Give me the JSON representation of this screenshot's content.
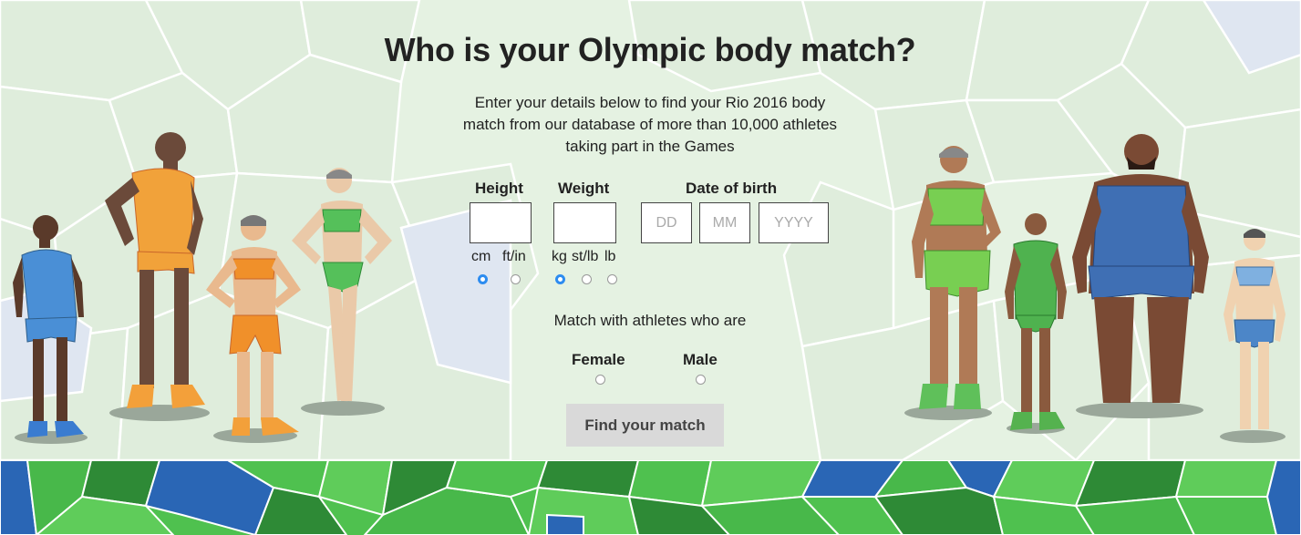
{
  "header": {
    "title": "Who is your Olympic body match?",
    "intro": "Enter your details below to find your Rio 2016 body match from our database of more than 10,000 athletes taking part in the Games"
  },
  "form": {
    "height": {
      "label": "Height",
      "value": "",
      "units": [
        "cm",
        "ft/in"
      ],
      "selected_unit": "cm"
    },
    "weight": {
      "label": "Weight",
      "value": "",
      "units": [
        "kg",
        "st/lb",
        "lb"
      ],
      "selected_unit": "kg"
    },
    "dob": {
      "label": "Date of birth",
      "day_placeholder": "DD",
      "month_placeholder": "MM",
      "year_placeholder": "YYYY"
    },
    "gender": {
      "prompt": "Match with athletes who are",
      "options": [
        "Female",
        "Male"
      ],
      "selected": null
    },
    "submit_label": "Find your match"
  },
  "colors": {
    "accent_radio": "#2d8cf0",
    "background": "#e6f3e3",
    "band_green": "#4fc14f",
    "band_dark_green": "#2e8a36",
    "band_blue": "#2a66b5",
    "button": "#d9d9d9"
  },
  "illustrations": [
    "athlete-blue-kit-icon",
    "athlete-orange-kit-icon",
    "athlete-orange-bikini-icon",
    "athlete-green-bikini-icon",
    "athlete-green-leotard-icon",
    "athlete-green-kit-icon",
    "athlete-heavy-blue-kit-icon",
    "athlete-blue-bikini-icon"
  ]
}
